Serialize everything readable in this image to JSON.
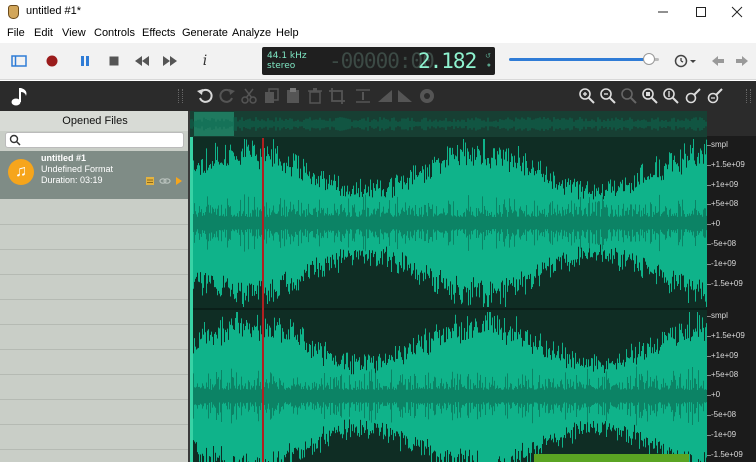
{
  "window": {
    "title": "untitled #1*",
    "min_icon": "minimize-icon",
    "max_icon": "maximize-icon",
    "close_icon": "close-icon"
  },
  "menu": [
    "File",
    "Edit",
    "View",
    "Controls",
    "Effects",
    "Generate",
    "Analyze",
    "Help"
  ],
  "transport": {
    "info_label": "i"
  },
  "display": {
    "rate": "44.1 kHz",
    "channels": "stereo",
    "time_ghost": "-00000:00",
    "time": "2.182"
  },
  "volume": {
    "level": 0.93
  },
  "sidebar": {
    "header": "Opened Files",
    "search_placeholder": "",
    "file": {
      "name": "untitled #1",
      "format": "Undefined Format",
      "duration": "Duration: 03:19"
    }
  },
  "ruler": {
    "unit": "smpl",
    "ch1": [
      "smpl",
      "+1.5e+09",
      "+1e+09",
      "+5e+08",
      "+0",
      "-5e+08",
      "-1e+09",
      "-1.5e+09"
    ],
    "ch2": [
      "smpl",
      "+1.5e+09",
      "+1e+09",
      "+5e+08",
      "+0",
      "-5e+08",
      "-1e+09",
      "-1.5e+09"
    ]
  },
  "colors": {
    "waveform": "#0fb38a",
    "waveform_bg": "#0f2d24",
    "accent": "#2f7cd6",
    "file_icon": "#f6a51c"
  }
}
